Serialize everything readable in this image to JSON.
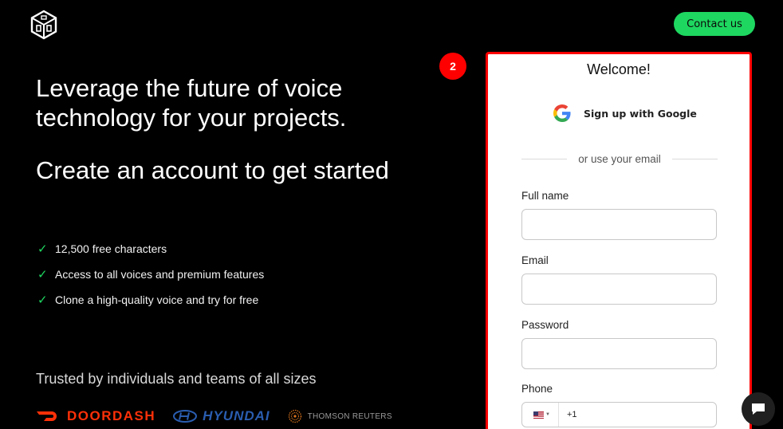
{
  "header": {
    "contact_label": "Contact us"
  },
  "hero": {
    "headline": "Leverage the future of voice technology for your projects.",
    "subheadline": "Create an account to get started"
  },
  "features": [
    {
      "icon": "check-icon",
      "text": "12,500 free characters"
    },
    {
      "icon": "check-icon",
      "text": "Access to all voices and premium features"
    },
    {
      "icon": "check-icon",
      "text": "Clone a high-quality voice and try for free"
    }
  ],
  "trusted": {
    "text": "Trusted by individuals and teams of all sizes",
    "brands": [
      "DOORDASH",
      "HYUNDAI",
      "THOMSON REUTERS"
    ]
  },
  "step_badge": "2",
  "signup": {
    "title": "Welcome!",
    "google_label": "Sign up with Google",
    "divider_text": "or use your email",
    "fields": {
      "full_name": {
        "label": "Full name",
        "value": "",
        "placeholder": ""
      },
      "email": {
        "label": "Email",
        "value": "",
        "placeholder": ""
      },
      "password": {
        "label": "Password",
        "value": "",
        "placeholder": ""
      },
      "phone": {
        "label": "Phone",
        "dial_code": "+1",
        "value": ""
      }
    }
  },
  "colors": {
    "accent": "#1ed760",
    "highlight": "#ff0000",
    "background": "#000000",
    "doordash": "#ff3008",
    "hyundai": "#2a5db0"
  }
}
